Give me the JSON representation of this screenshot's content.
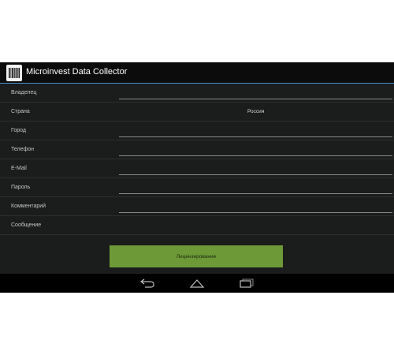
{
  "actionbar": {
    "title": "Microinvest Data Collector",
    "icon": "barcode-icon"
  },
  "form": {
    "owner_label": "Владелец",
    "owner_value": "",
    "country_label": "Страна",
    "country_value": "Россия",
    "city_label": "Город",
    "city_value": "",
    "phone_label": "Телефон",
    "phone_value": "",
    "email_label": "E-Mail",
    "email_value": "",
    "password_label": "Пароль",
    "password_value": "",
    "comment_label": "Комментарий",
    "comment_value": "",
    "message_label": "Сообщение"
  },
  "license_button_label": "Лицензирование",
  "navbar": {
    "back_icon": "back-icon",
    "home_icon": "home-icon",
    "recent_icon": "recent-apps-icon"
  },
  "colors": {
    "background": "#1b1c1c",
    "actionbar": "#0c0c0c",
    "accent_line": "#3f8fc9",
    "button": "#6d9a37",
    "navbar": "#000000"
  }
}
